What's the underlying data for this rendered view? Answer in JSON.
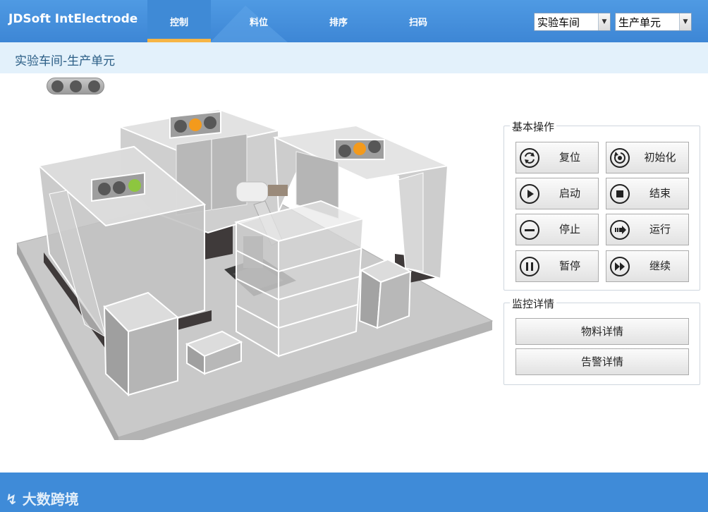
{
  "app": {
    "title": "JDSoft IntElectrode"
  },
  "nav": {
    "tabs": [
      {
        "label": "控制",
        "active": true
      },
      {
        "label": "料位",
        "active": false
      },
      {
        "label": "排序",
        "active": false
      },
      {
        "label": "扫码",
        "active": false
      }
    ]
  },
  "selectors": {
    "workshop": "实验车间",
    "unit": "生产单元"
  },
  "breadcrumb": "实验车间-生产单元",
  "status_lights": {
    "main": [
      "off",
      "off",
      "off"
    ],
    "machine_left": [
      "off",
      "off",
      "green"
    ],
    "machine_back": [
      "off",
      "orange",
      "off"
    ],
    "machine_right": [
      "off",
      "orange",
      "off"
    ]
  },
  "basic_ops": {
    "title": "基本操作",
    "buttons": [
      {
        "label": "复位",
        "icon": "reset-icon"
      },
      {
        "label": "初始化",
        "icon": "init-icon"
      },
      {
        "label": "启动",
        "icon": "play-icon"
      },
      {
        "label": "结束",
        "icon": "stop-icon"
      },
      {
        "label": "停止",
        "icon": "minus-icon"
      },
      {
        "label": "运行",
        "icon": "run-icon"
      },
      {
        "label": "暂停",
        "icon": "pause-icon"
      },
      {
        "label": "继续",
        "icon": "fast-forward-icon"
      }
    ]
  },
  "monitor": {
    "title": "监控详情",
    "buttons": [
      {
        "label": "物料详情"
      },
      {
        "label": "告警详情"
      }
    ]
  },
  "watermark": "大数跨境",
  "colors": {
    "header": "#3d86d5",
    "accent": "#f6b545",
    "subbar": "#e3f1fb",
    "light_off": "#575757",
    "light_green": "#8dc63f",
    "light_orange": "#f39a1c"
  }
}
